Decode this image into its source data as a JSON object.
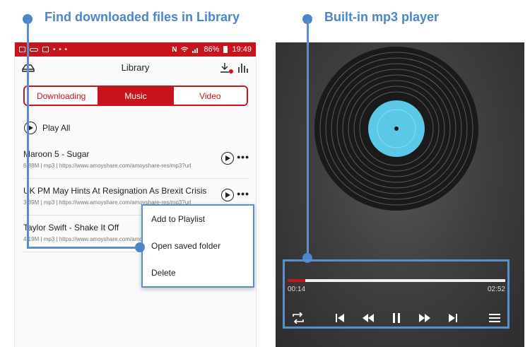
{
  "captions": {
    "left": "Find downloaded files in Library",
    "right": "Built-in mp3 player"
  },
  "status_bar": {
    "battery": "86%",
    "time": "19:49"
  },
  "library": {
    "title": "Library",
    "tabs": [
      {
        "label": "Downloading",
        "active": false
      },
      {
        "label": "Music",
        "active": true
      },
      {
        "label": "Video",
        "active": false
      }
    ],
    "play_all": "Play All",
    "tracks": [
      {
        "title": "Maroon 5 - Sugar",
        "meta": "6.88M | mp3 | https://www.amoyshare.com/amoyshare-res/mp3?url"
      },
      {
        "title": "UK PM May Hints At Resignation As Brexit Crisis",
        "meta": "3.89M | mp3 | https://www.amoyshare.com/amoyshare-res/mp3?url"
      },
      {
        "title": "Taylor Swift - Shake It Off",
        "meta": "4.19M | mp3 | https://www.amoyshare.com/amoyshare-res/mp3?url"
      }
    ],
    "context_menu": [
      {
        "label": "Add to Playlist"
      },
      {
        "label": "Open saved folder"
      },
      {
        "label": "Delete"
      }
    ]
  },
  "player": {
    "current_time": "00:14",
    "total_time": "02:52",
    "progress_fraction": 0.08,
    "accent_color": "#c8141c",
    "label_color": "#5bc8e8",
    "controls": [
      "repeat-icon",
      "skip-previous-icon",
      "rewind-icon",
      "pause-icon",
      "fast-forward-icon",
      "skip-next-icon",
      "menu-icon"
    ]
  }
}
